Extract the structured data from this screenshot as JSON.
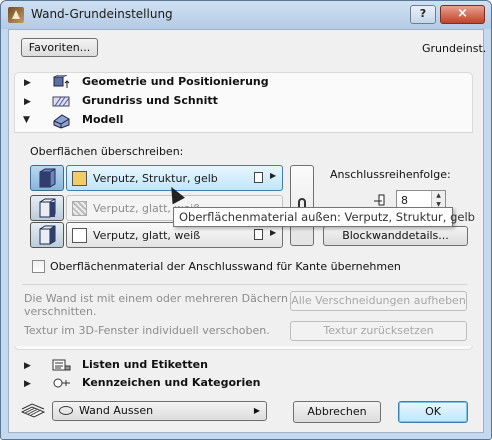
{
  "window": {
    "title": "Wand-Grundeinstellung",
    "help_label": "?",
    "close_label": "×"
  },
  "top": {
    "favorites_label": "Favoriten...",
    "defaults_label": "Grundeinst."
  },
  "sections": [
    {
      "label": "Geometrie und Positionierung",
      "icon": "geometry-icon",
      "expanded": false
    },
    {
      "label": "Grundriss und Schnitt",
      "icon": "floorplan-icon",
      "expanded": false
    },
    {
      "label": "Modell",
      "icon": "model-icon",
      "expanded": true
    },
    {
      "label": "Listen und Etiketten",
      "icon": "list-icon",
      "expanded": false
    },
    {
      "label": "Kennzeichen und Kategorien",
      "icon": "category-icon",
      "expanded": false
    }
  ],
  "modell": {
    "override_label": "Oberflächen überschreiben:",
    "materials": [
      {
        "name": "Verputz, Struktur, gelb",
        "color": "#f2cc64",
        "state": "active"
      },
      {
        "name": "Verputz, glatt, weiß",
        "color": "#e6e6e6",
        "state": "disabled"
      },
      {
        "name": "Verputz, glatt, weiß",
        "color": "#ffffff",
        "state": "normal"
      }
    ],
    "tooltip": "Oberflächenmaterial außen: Verputz, Struktur, gelb",
    "connection_order_label": "Anschlussreihenfolge:",
    "connection_order_value": "8",
    "block_button_label": "Blockwanddetails...",
    "checkbox_label": "Oberflächenmaterial der Anschlusswand für Kante übernehmen",
    "roof_text_line1": "Die Wand ist mit einem oder mehreren Dächern",
    "roof_text_line2": "verschnitten.",
    "cut_button_label": "Alle Verschneidungen aufheben",
    "texture_text": "Textur im 3D-Fenster individuell verschoben.",
    "texture_button_label": "Textur zurücksetzen"
  },
  "bottom": {
    "layer_label": "Wand Aussen",
    "cancel_label": "Abbrechen",
    "ok_label": "OK"
  },
  "colors": {
    "active_material_bg": "#bee6fd",
    "window_frame": "#c4d8ee"
  }
}
